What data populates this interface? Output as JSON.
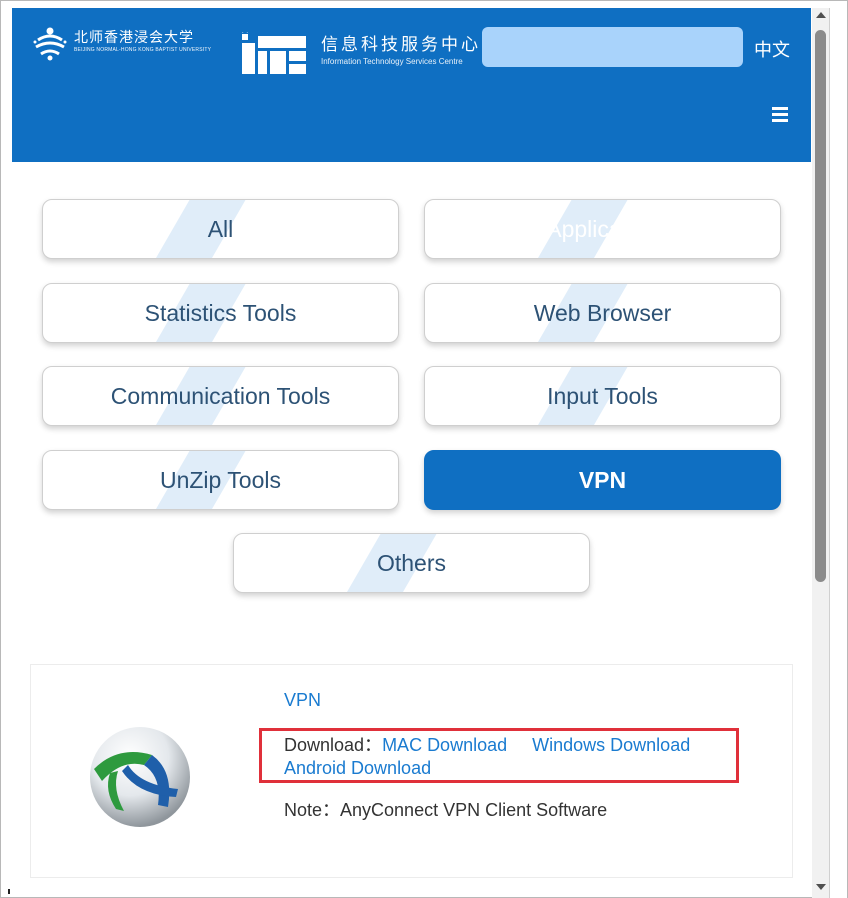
{
  "header": {
    "bnu_name_cn": "北师香港浸会大学",
    "bnu_name_en": "BEIJING NORMAL-HONG KONG BAPTIST UNIVERSITY",
    "itc_name_cn": "信息科技服务中心",
    "itc_name_en": "Information Technology Services Centre",
    "search_value": "",
    "lang_label": "中文",
    "brand_color": "#0f6fc2"
  },
  "categories": [
    {
      "label": "All"
    },
    {
      "label": "Application"
    },
    {
      "label": "Statistics Tools"
    },
    {
      "label": "Web Browser"
    },
    {
      "label": "Communication Tools"
    },
    {
      "label": "Input Tools"
    },
    {
      "label": "UnZip Tools"
    },
    {
      "label": "VPN",
      "active": true
    },
    {
      "label": "Others"
    }
  ],
  "software": {
    "title": "VPN",
    "download_label": "Download：",
    "mac_link": "MAC Download",
    "windows_link": "Windows Download",
    "android_link": "Android Download",
    "note": "Note：AnyConnect VPN Client Software",
    "icon": "anyconnect-globe-icon"
  }
}
